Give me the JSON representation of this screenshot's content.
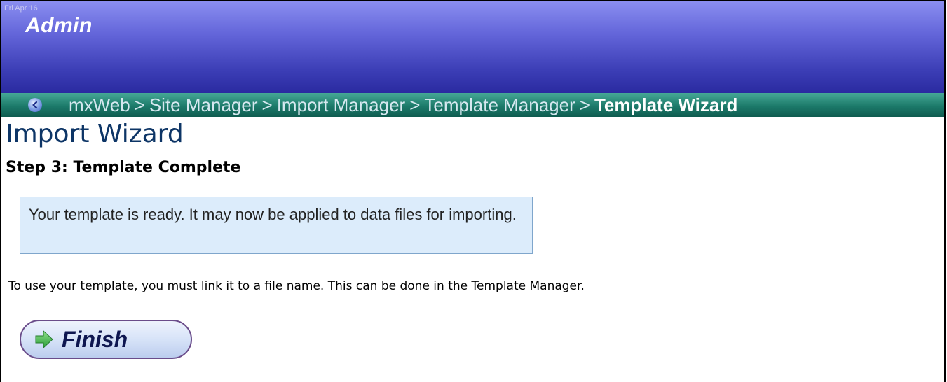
{
  "header": {
    "date": "Fri Apr 16",
    "title": "Admin"
  },
  "breadcrumb": {
    "items": [
      "mxWeb",
      "Site Manager",
      "Import Manager",
      "Template Manager"
    ],
    "separator": ">",
    "current": "Template Wizard"
  },
  "main": {
    "title": "Import Wizard",
    "step_title": "Step 3: Template Complete",
    "info_message": "Your template is ready. It may now be applied to data files for importing.",
    "note": "To use your template, you must link it to a file name. This can be done in the Template Manager.",
    "finish_label": "Finish"
  },
  "icons": {
    "back": "back-arrow-icon",
    "finish": "arrow-right-icon"
  },
  "colors": {
    "header_top": "#8a8ef0",
    "header_bottom": "#2a2aa0",
    "nav_bar": "#1c7a6a",
    "title": "#0d3566",
    "info_box": "#dcecfb",
    "finish_arrow": "#3db84a"
  }
}
